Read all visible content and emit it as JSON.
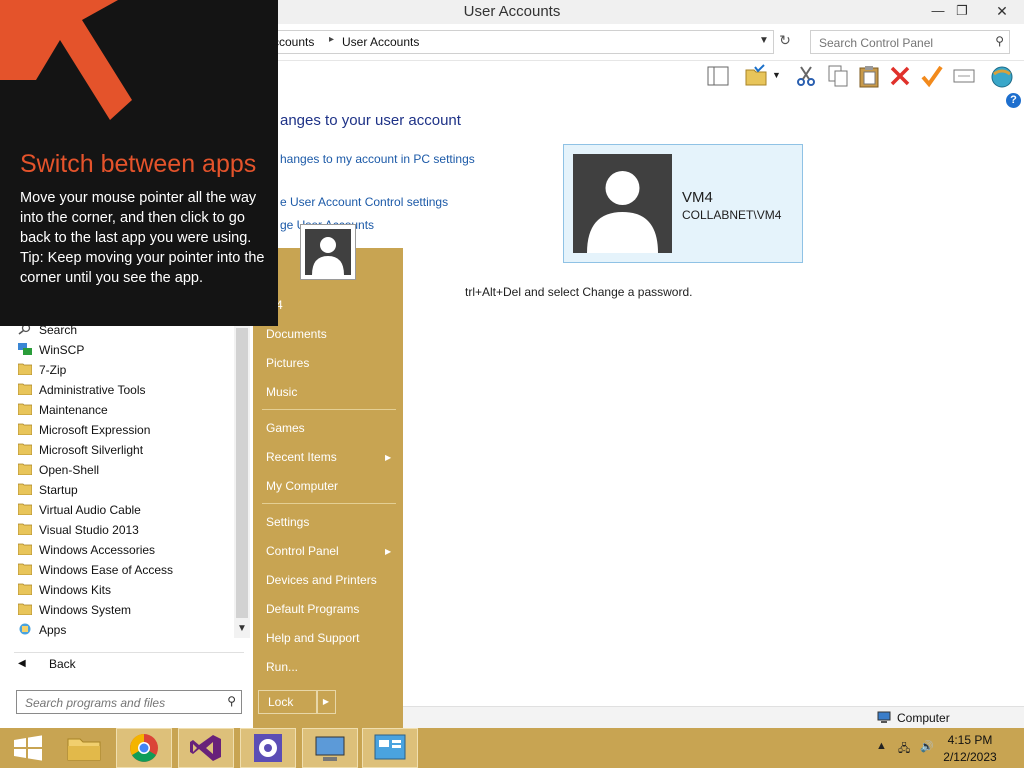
{
  "window": {
    "title": "User Accounts",
    "minimize_glyph": "—",
    "restore_glyph": "❐",
    "close_glyph": "✕"
  },
  "address": {
    "crumbs": [
      "ccounts",
      "User Accounts"
    ],
    "search_placeholder": "Search Control Panel"
  },
  "content": {
    "heading": "anges to your user account",
    "links": [
      "hanges to my account in PC settings",
      "e User Account Control settings",
      "ge User Accounts"
    ],
    "password_note": "trl+Alt+Del and select Change a password.",
    "user_card": {
      "name": "VM4",
      "domain": "COLLABNET\\VM4"
    }
  },
  "help_glyph": "?",
  "status_bar": {
    "location": "Computer"
  },
  "tip": {
    "title": "Switch between apps",
    "body_line1": "Move your mouse pointer all the way into the corner, and then click to go back to the last app you were using.",
    "body_line2": "Tip: Keep moving your pointer into the corner until you see the app."
  },
  "start_menu": {
    "programs": [
      {
        "label": "Search",
        "icon": "search-icon"
      },
      {
        "label": "WinSCP",
        "icon": "winscp-icon"
      },
      {
        "label": "7-Zip",
        "icon": "folder-icon"
      },
      {
        "label": "Administrative Tools",
        "icon": "folder-icon"
      },
      {
        "label": "Maintenance",
        "icon": "folder-icon"
      },
      {
        "label": "Microsoft Expression",
        "icon": "folder-icon"
      },
      {
        "label": "Microsoft Silverlight",
        "icon": "folder-icon"
      },
      {
        "label": "Open-Shell",
        "icon": "folder-icon"
      },
      {
        "label": "Startup",
        "icon": "folder-icon"
      },
      {
        "label": "Virtual Audio Cable",
        "icon": "folder-icon"
      },
      {
        "label": "Visual Studio 2013",
        "icon": "folder-icon"
      },
      {
        "label": "Windows Accessories",
        "icon": "folder-icon"
      },
      {
        "label": "Windows Ease of Access",
        "icon": "folder-icon"
      },
      {
        "label": "Windows Kits",
        "icon": "folder-icon"
      },
      {
        "label": "Windows System",
        "icon": "folder-icon"
      },
      {
        "label": "Apps",
        "icon": "apps-icon"
      }
    ],
    "back_label": "Back",
    "search_placeholder": "Search programs and files",
    "user_label": "M4",
    "right_items": {
      "documents": "Documents",
      "pictures": "Pictures",
      "music": "Music",
      "games": "Games",
      "recent_items": "Recent Items",
      "my_computer": "My Computer",
      "settings": "Settings",
      "control_panel": "Control Panel",
      "devices_printers": "Devices and Printers",
      "default_programs": "Default Programs",
      "help_support": "Help and Support",
      "run": "Run..."
    },
    "lock_label": "Lock"
  },
  "taskbar": {
    "time": "4:15 PM",
    "date": "2/12/2023",
    "apps": [
      "start-button",
      "file-explorer",
      "chrome",
      "visual-studio",
      "settings",
      "remote-desktop",
      "control-panel"
    ]
  },
  "colors": {
    "accent_gold": "#c8a452",
    "tip_orange": "#e4532b",
    "link_blue": "#1c5aa8",
    "card_bg": "#e5f3fb"
  }
}
